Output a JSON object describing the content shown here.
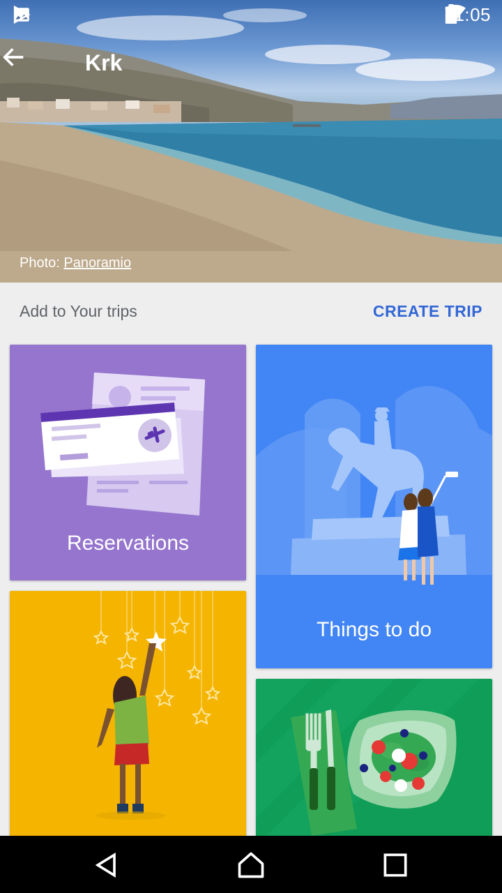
{
  "status_bar": {
    "time": "11:05",
    "left_icons": [
      "image-icon",
      "play-store-check-icon"
    ],
    "right_icons": [
      "bluetooth-icon",
      "wifi-icon",
      "signal-icon",
      "battery-icon"
    ]
  },
  "header": {
    "title": "Krk",
    "photo_credit_prefix": "Photo: ",
    "photo_credit_link": "Panoramio"
  },
  "section": {
    "label": "Add to Your trips",
    "action": "CREATE TRIP"
  },
  "cards": {
    "reservations": {
      "label": "Reservations",
      "color": "#9575cd"
    },
    "things_to_do": {
      "label": "Things to do",
      "color": "#4285f4"
    },
    "saved": {
      "label": "",
      "color": "#f4b400"
    },
    "food": {
      "label": "",
      "color": "#0f9d58"
    }
  },
  "colors": {
    "accent": "#3367d6",
    "background": "#eeeeee"
  }
}
